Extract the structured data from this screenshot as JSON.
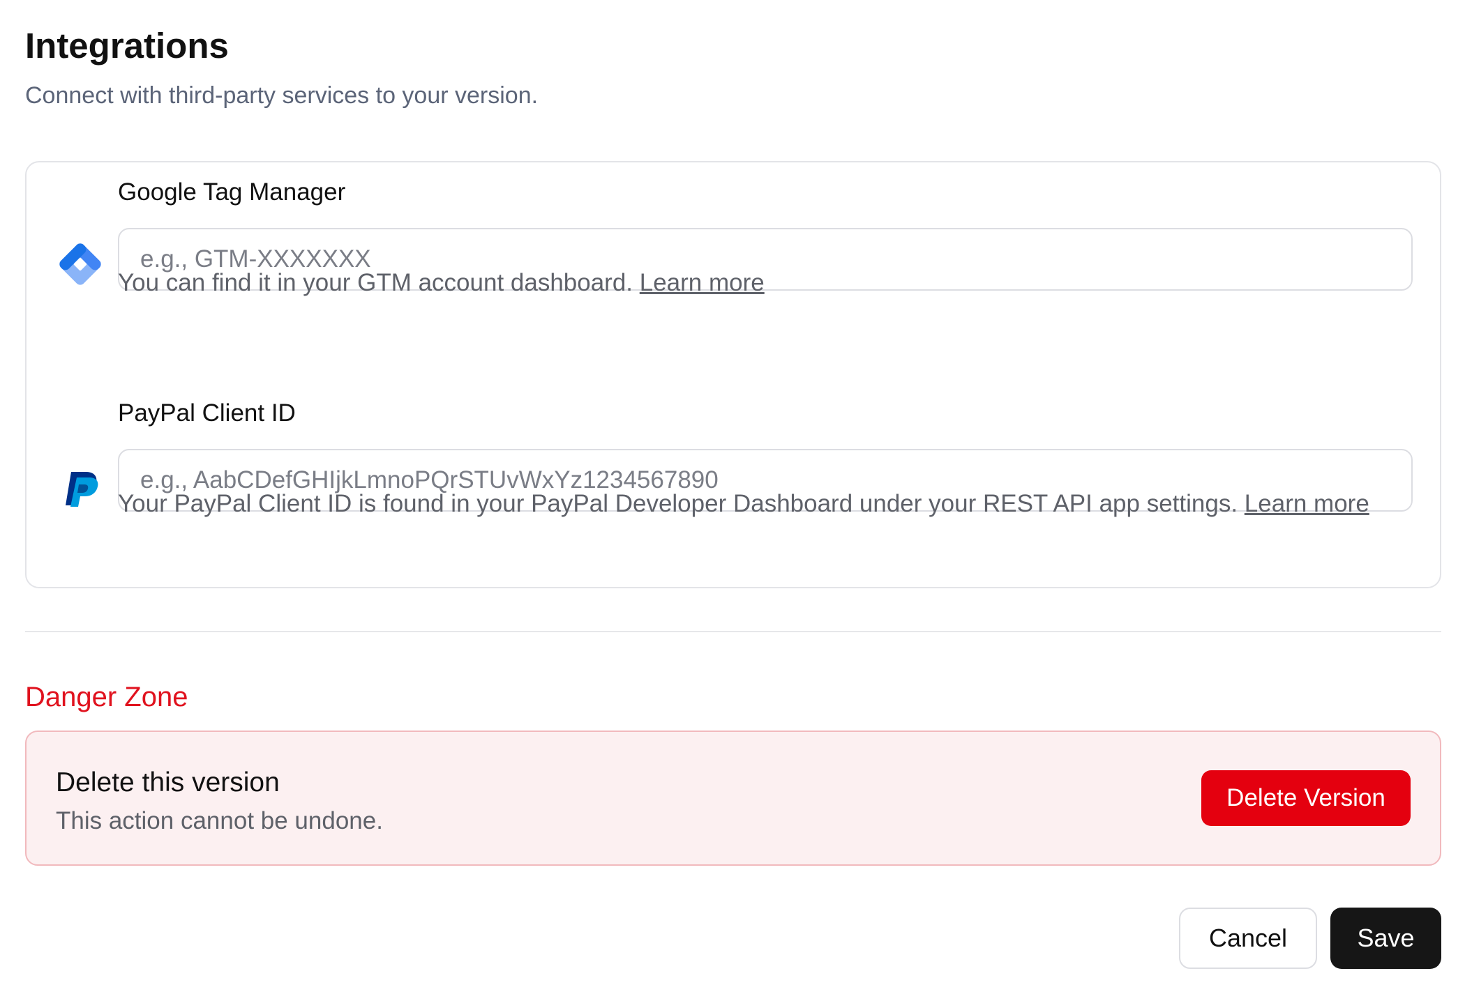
{
  "header": {
    "title": "Integrations",
    "subtitle": "Connect with third-party services to your version."
  },
  "integrations": [
    {
      "icon": "google-tag-manager-icon",
      "label": "Google Tag Manager",
      "placeholder": "e.g., GTM-XXXXXXX",
      "value": "",
      "help_text": "You can find it in your GTM account dashboard.",
      "link_text": "Learn more"
    },
    {
      "icon": "paypal-icon",
      "label": "PayPal Client ID",
      "placeholder": "e.g., AabCDefGHIjkLmnoPQrSTUvWxYz1234567890",
      "value": "",
      "help_text": "Your PayPal Client ID is found in your PayPal Developer Dashboard under your REST API app settings.",
      "link_text": "Learn more"
    }
  ],
  "danger_zone": {
    "title": "Danger Zone",
    "item_title": "Delete this version",
    "item_description": "This action cannot be undone.",
    "button_label": "Delete Version"
  },
  "footer": {
    "cancel_label": "Cancel",
    "save_label": "Save"
  },
  "colors": {
    "danger": "#e4000f",
    "danger_background": "#fcf0f1",
    "primary_button": "#161616",
    "gtm_blue": "#4285f4",
    "paypal_dark": "#003087",
    "paypal_light": "#009cde"
  }
}
